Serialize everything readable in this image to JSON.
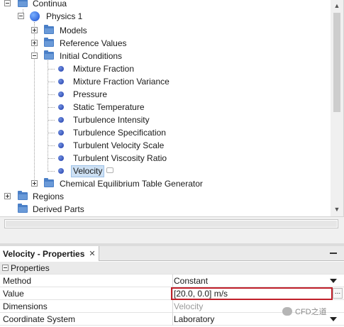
{
  "tree": {
    "nodes": [
      {
        "label": "Continua",
        "icon": "folder-icon",
        "expander": "minus"
      },
      {
        "label": "Physics 1",
        "icon": "globe-icon",
        "expander": "minus"
      },
      {
        "label": "Models",
        "icon": "folder-icon",
        "expander": "plus"
      },
      {
        "label": "Reference Values",
        "icon": "folder-icon",
        "expander": "plus"
      },
      {
        "label": "Initial Conditions",
        "icon": "folder-icon",
        "expander": "minus"
      },
      {
        "label": "Mixture Fraction",
        "icon": "dot-icon"
      },
      {
        "label": "Mixture Fraction Variance",
        "icon": "dot-icon"
      },
      {
        "label": "Pressure",
        "icon": "dot-icon"
      },
      {
        "label": "Static Temperature",
        "icon": "dot-icon"
      },
      {
        "label": "Turbulence Intensity",
        "icon": "dot-icon"
      },
      {
        "label": "Turbulence Specification",
        "icon": "dot-icon"
      },
      {
        "label": "Turbulent Velocity Scale",
        "icon": "dot-icon"
      },
      {
        "label": "Turbulent Viscosity Ratio",
        "icon": "dot-icon"
      },
      {
        "label": "Velocity",
        "icon": "dot-icon",
        "selected": true
      },
      {
        "label": "Chemical Equilibrium Table Generator",
        "icon": "folder-icon",
        "expander": "plus"
      },
      {
        "label": "Regions",
        "icon": "folder-icon",
        "expander": "plus"
      },
      {
        "label": "Derived Parts",
        "icon": "folder-icon"
      }
    ]
  },
  "properties": {
    "tab_title": "Velocity - Properties",
    "close_glyph": "✕",
    "section_label": "Properties",
    "rows": [
      {
        "name": "Method",
        "value": "Constant"
      },
      {
        "name": "Value",
        "value": "[20.0, 0.0] m/s"
      },
      {
        "name": "Dimensions",
        "value": "Velocity"
      },
      {
        "name": "Coordinate System",
        "value": "Laboratory"
      }
    ],
    "ellipsis": "..."
  },
  "watermark": {
    "text": "CFD之道"
  },
  "colors": {
    "accent_selection": "#cde0f3",
    "highlight_box": "#c0202a",
    "folder": "#4a7fc7"
  }
}
